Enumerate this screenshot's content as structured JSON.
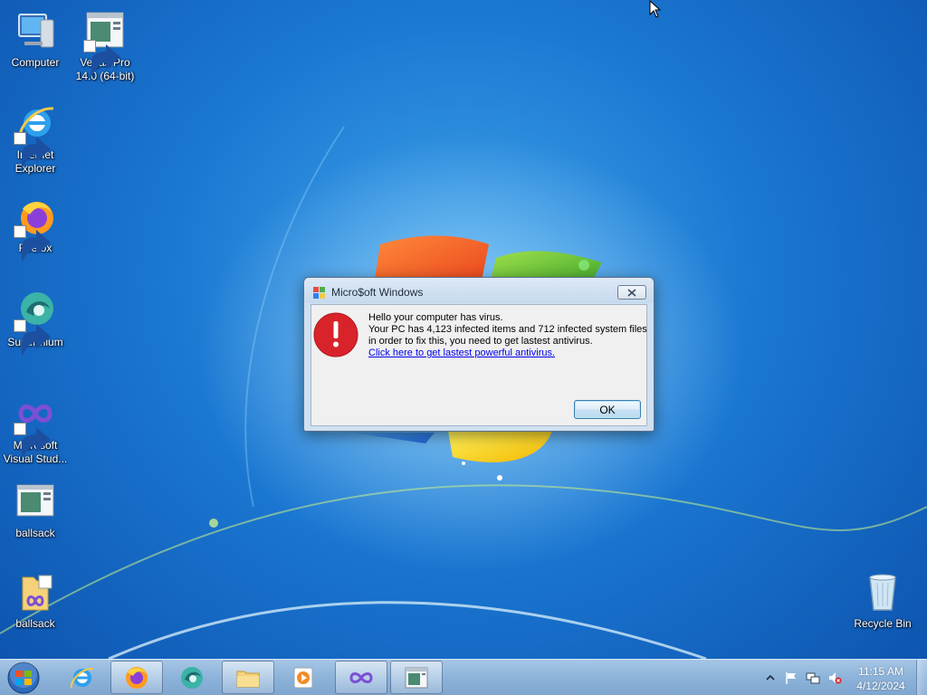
{
  "desktop": {
    "icons": [
      {
        "label": "Computer",
        "icon": "computer-icon"
      },
      {
        "label": "Vegas Pro 14.0 (64-bit)",
        "icon": "vegas-pro-icon"
      },
      {
        "label": "Internet Explorer",
        "icon": "internet-explorer-icon"
      },
      {
        "label": "Firefox",
        "icon": "firefox-icon"
      },
      {
        "label": "Supermium",
        "icon": "supermium-icon"
      },
      {
        "label": "Microsoft Visual Stud...",
        "icon": "visual-studio-icon"
      },
      {
        "label": "ballsack",
        "icon": "application-icon"
      },
      {
        "label": "ballsack",
        "icon": "folder-icon"
      },
      {
        "label": "Recycle Bin",
        "icon": "recycle-bin-icon"
      }
    ]
  },
  "dialog": {
    "title": "Micro$oft Windows",
    "icon": "error-icon",
    "lines": [
      "Hello your computer has virus.",
      "Your PC has 4,123 infected items and 712 infected system files",
      "in order to fix this, you need to get lastest antivirus."
    ],
    "link_text": "Click here to get lastest powerful antivirus.",
    "ok_label": "OK"
  },
  "taskbar": {
    "items": [
      {
        "name": "internet-explorer",
        "active": false
      },
      {
        "name": "firefox",
        "active": true
      },
      {
        "name": "supermium",
        "active": false
      },
      {
        "name": "file-explorer",
        "active": true
      },
      {
        "name": "media-player",
        "active": false
      },
      {
        "name": "visual-studio",
        "active": true
      },
      {
        "name": "application-window",
        "active": true
      }
    ],
    "clock_time": "11:15 AM",
    "clock_date": "4/12/2024"
  },
  "colors": {
    "error_red": "#d9232a",
    "link_blue": "#0000ee",
    "taskbar": "#8db3da"
  }
}
